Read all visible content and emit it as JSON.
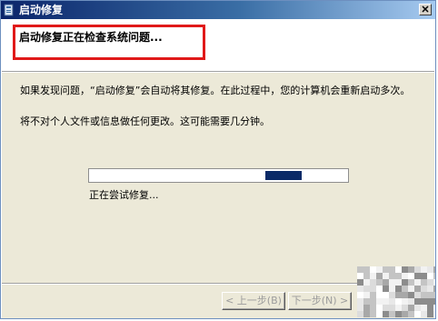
{
  "window": {
    "title": "启动修复",
    "close_icon": "close-icon",
    "title_icon": "startup-repair-icon"
  },
  "header": {
    "title": "启动修复正在检查系统问题..."
  },
  "body": {
    "paragraph1": "如果发现问题，“启动修复”会自动将其修复。在此过程中，您的计算机会重新启动多次。",
    "paragraph2": "将不对个人文件或信息做任何更改。这可能需要几分钟。",
    "status": "正在尝试修复..."
  },
  "progress": {
    "style": "marquee",
    "block_position_fraction": 0.68,
    "block_width_fraction": 0.14
  },
  "buttons": {
    "back": "< 上一步(B)",
    "next": "下一步(N) >"
  },
  "colors": {
    "highlight": "#e01919",
    "progress_block": "#0a2a67",
    "titlebar": "#0a246a"
  }
}
